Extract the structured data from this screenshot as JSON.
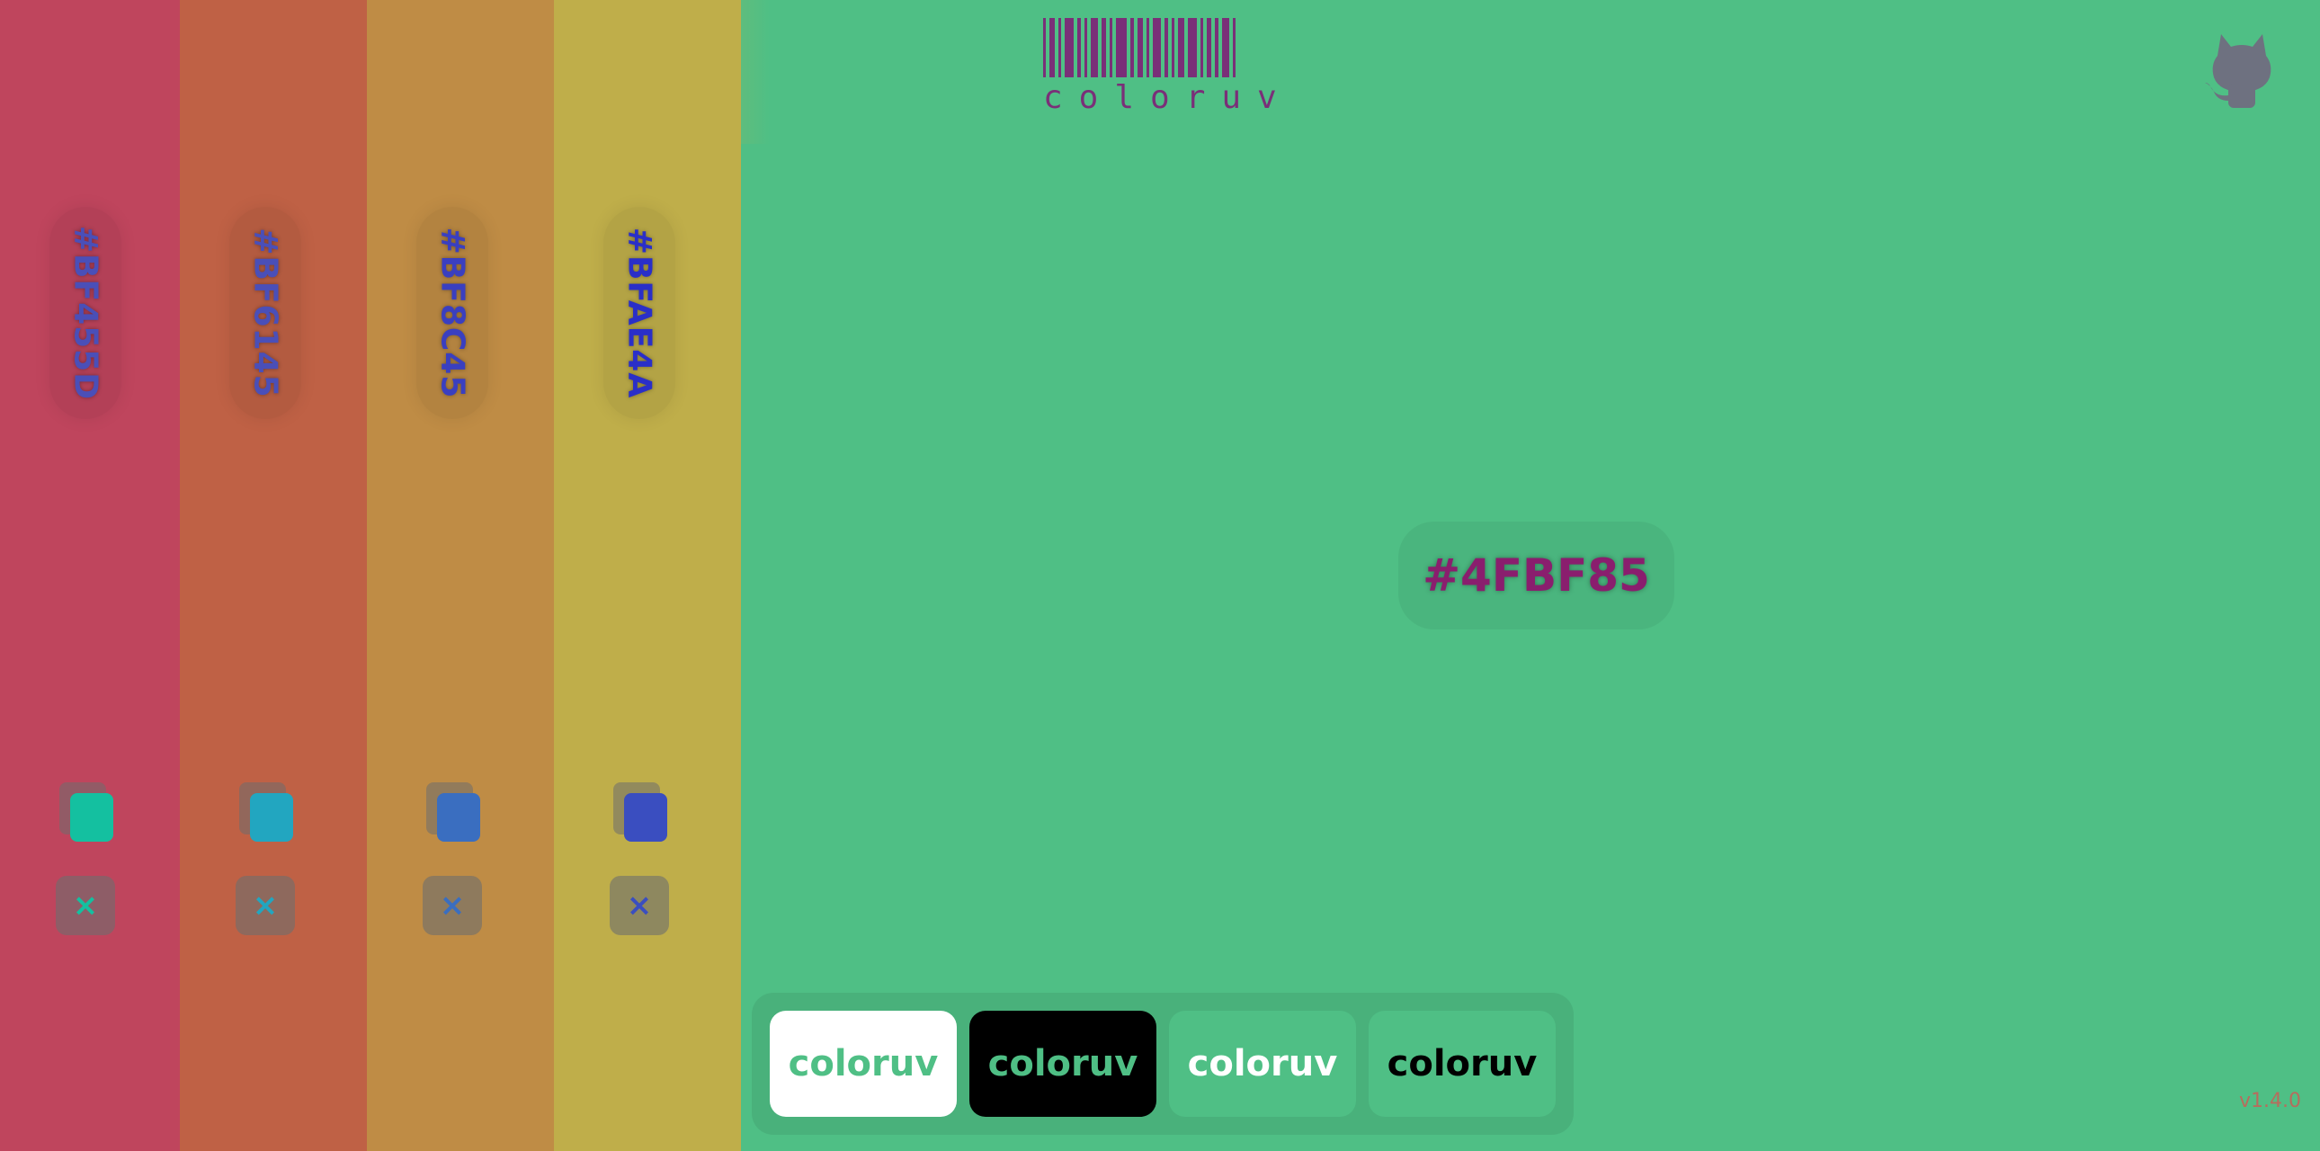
{
  "main": {
    "hex": "#4FBF85",
    "background": "#4FBF85",
    "text_color": "#8A1E6E"
  },
  "header": {
    "logo_text": "coloruv",
    "logo_color": "#7A2F78"
  },
  "github": {
    "icon": "github-octocat-icon",
    "color": "#6E7180"
  },
  "palette": [
    {
      "hex": "#BF455D",
      "background": "#BF455D",
      "text_color": "#4A4FB8",
      "copy_color": "#14C0A0",
      "remove_color": "#14C0A0",
      "copy_icon": "copy-icon",
      "remove_label": "×"
    },
    {
      "hex": "#BF6145",
      "background": "#BF6145",
      "text_color": "#4A4FB8",
      "copy_color": "#22A6C0",
      "remove_color": "#22A6C0",
      "copy_icon": "copy-icon",
      "remove_label": "×"
    },
    {
      "hex": "#BF8C45",
      "background": "#BF8C45",
      "text_color": "#3A3FC0",
      "copy_color": "#3A6EC0",
      "remove_color": "#3A6EC0",
      "copy_icon": "copy-icon",
      "remove_label": "×"
    },
    {
      "hex": "#BFAE4A",
      "background": "#BFAE4A",
      "text_color": "#2A2FC8",
      "copy_color": "#3A4EC0",
      "remove_color": "#3A4EC0",
      "copy_icon": "copy-icon",
      "remove_label": "×"
    }
  ],
  "previews": [
    {
      "label": "coloruv",
      "background": "#FFFFFF",
      "text_color": "#4FBF85"
    },
    {
      "label": "coloruv",
      "background": "#000000",
      "text_color": "#4FBF85"
    },
    {
      "label": "coloruv",
      "background": "#4FBF85",
      "text_color": "#FFFFFF"
    },
    {
      "label": "coloruv",
      "background": "#4FBF85",
      "text_color": "#000000"
    }
  ],
  "version": "v1.4.0"
}
